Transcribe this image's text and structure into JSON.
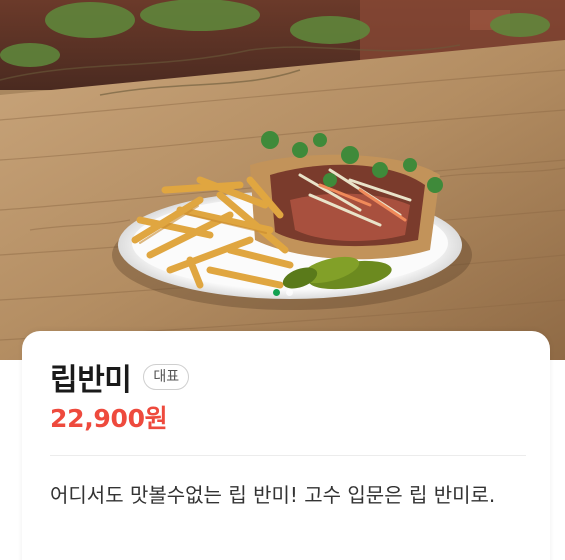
{
  "hero": {
    "image_alt_subject": "sandwich with french fries and pickles on a white plate",
    "carousel_total": 2,
    "carousel_active_index": 0,
    "active_dot_color": "#12a150"
  },
  "menu": {
    "name": "립반미",
    "badge": "대표",
    "price": "22,900원",
    "description": "어디서도 맛볼수없는 립 반미! 고수 입문은 립 반미로.",
    "price_color": "#ee4a3d"
  }
}
